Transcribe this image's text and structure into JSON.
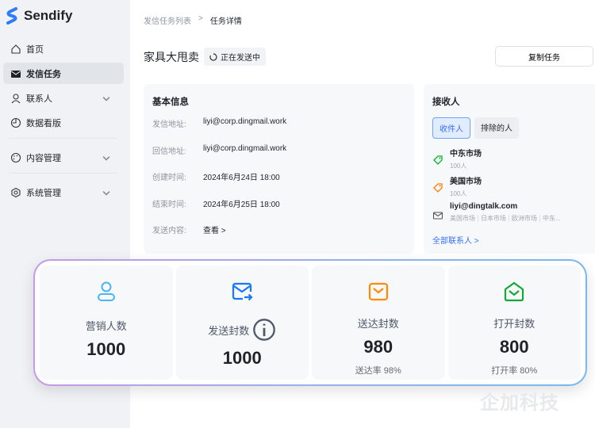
{
  "app": {
    "name": "Sendify"
  },
  "sidebar": {
    "items": [
      {
        "label": "首页",
        "icon": "home-icon"
      },
      {
        "label": "发信任务",
        "icon": "mail-icon",
        "active": true
      },
      {
        "label": "联系人",
        "icon": "user-icon",
        "expandable": true
      },
      {
        "label": "数据看版",
        "icon": "dashboard-icon"
      },
      {
        "label": "内容管理",
        "icon": "palette-icon",
        "expandable": true
      },
      {
        "label": "系统管理",
        "icon": "settings-icon",
        "expandable": true
      }
    ]
  },
  "breadcrumb": {
    "parent": "发信任务列表",
    "separator": ">",
    "current": "任务详情"
  },
  "task": {
    "title": "家具大甩卖",
    "status": "正在发送中",
    "copy_label": "复制任务"
  },
  "info": {
    "title": "基本信息",
    "rows": [
      {
        "k": "发信地址:",
        "v": "liyi@corp.dingmail.work"
      },
      {
        "k": "回信地址:",
        "v": "liyi@corp.dingmail.work"
      },
      {
        "k": "创建时间:",
        "v": "2024年6月24日 18:00"
      },
      {
        "k": "结束时间:",
        "v": "2024年6月25日 18:00"
      },
      {
        "k": "发送内容:",
        "v": "查看 >"
      }
    ]
  },
  "recipients": {
    "title": "接收人",
    "tabs": [
      "收件人",
      "排除的人"
    ],
    "items": [
      {
        "name": "中东市场",
        "sub": "100人",
        "color": "#00b42a"
      },
      {
        "name": "美国市场",
        "sub": "100人",
        "color": "#ff7d00"
      },
      {
        "name": "liyi@dingtalk.com",
        "tags": [
          "美国市场",
          "日本市场",
          "欧洲市场",
          "中东..."
        ]
      }
    ],
    "all_label": "全部联系人 >"
  },
  "stats": [
    {
      "label": "营销人数",
      "value": "1000",
      "color": "#4cb3f5"
    },
    {
      "label": "发送封数",
      "value": "1000",
      "color": "#1677ff",
      "info": true
    },
    {
      "label": "送达封数",
      "value": "980",
      "sub": "送达率 98%",
      "color": "#ff8a00"
    },
    {
      "label": "打开封数",
      "value": "800",
      "sub": "打开率 80%",
      "color": "#14a83b"
    }
  ],
  "watermark": "企加科技"
}
